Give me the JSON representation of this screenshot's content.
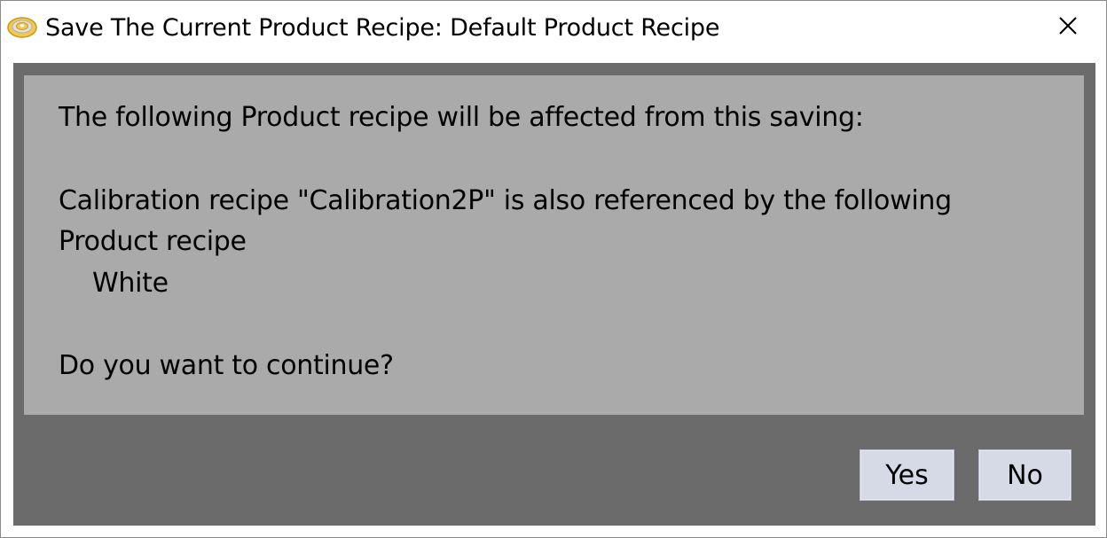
{
  "window": {
    "title": "Save The Current Product Recipe: Default Product Recipe",
    "app_icon": "target-icon",
    "close_icon": "close-icon"
  },
  "message": {
    "line1": "The following Product recipe will be affected from this saving:",
    "line2": "Calibration recipe \"Calibration2P\" is also referenced by the following",
    "line3": "Product recipe",
    "line4": "White",
    "line5": "Do you want to continue?"
  },
  "buttons": {
    "yes_label": "Yes",
    "no_label": "No"
  },
  "colors": {
    "body_background": "#6b6b6b",
    "message_background": "#aaaaaa",
    "button_background": "#d6dae6"
  }
}
